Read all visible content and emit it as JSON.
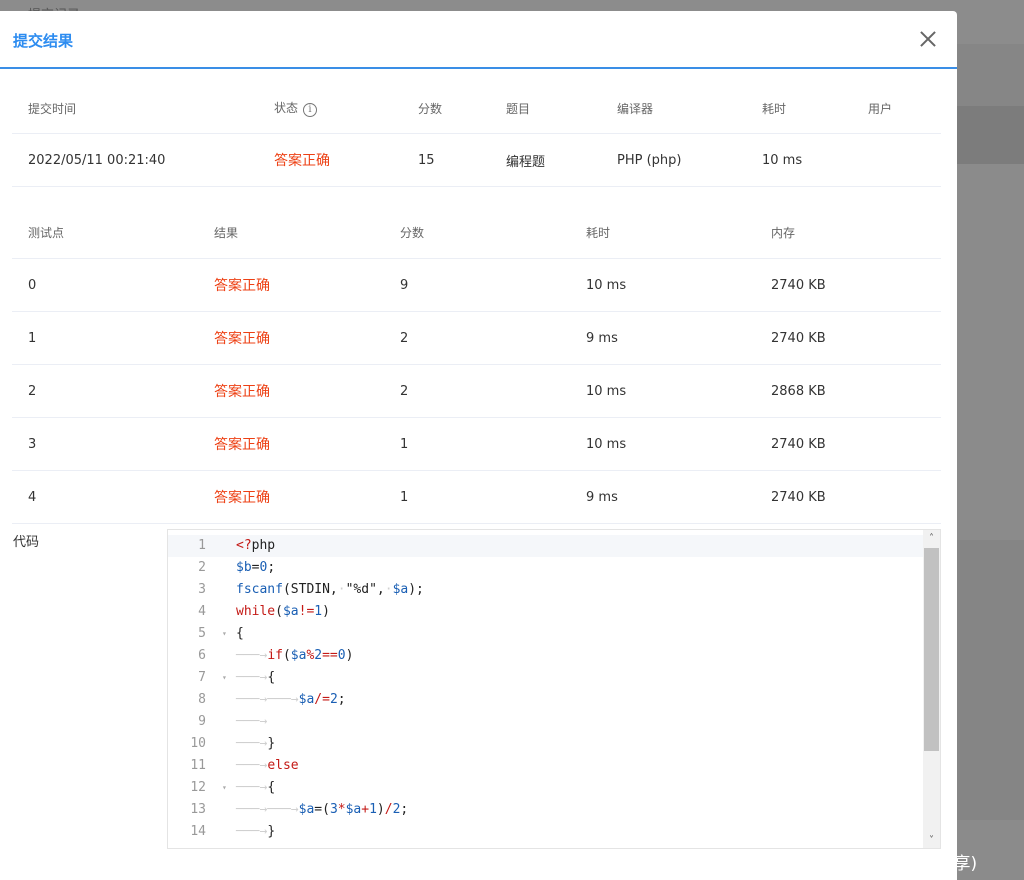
{
  "background": {
    "header_text": "提交记录"
  },
  "modal": {
    "title": "提交结果",
    "summary": {
      "headers": [
        "提交时间",
        "状态",
        "分数",
        "题目",
        "编译器",
        "耗时",
        "用户"
      ],
      "row": {
        "time": "2022/05/11 00:21:40",
        "status": "答案正确",
        "score": "15",
        "problem": "编程题",
        "compiler": "PHP (php)",
        "elapsed": "10 ms",
        "user": ""
      }
    },
    "cases": {
      "headers": [
        "测试点",
        "结果",
        "分数",
        "耗时",
        "内存"
      ],
      "rows": [
        {
          "id": "0",
          "result": "答案正确",
          "score": "9",
          "time": "10 ms",
          "memory": "2740 KB"
        },
        {
          "id": "1",
          "result": "答案正确",
          "score": "2",
          "time": "9 ms",
          "memory": "2740 KB"
        },
        {
          "id": "2",
          "result": "答案正确",
          "score": "2",
          "time": "10 ms",
          "memory": "2868 KB"
        },
        {
          "id": "3",
          "result": "答案正确",
          "score": "1",
          "time": "10 ms",
          "memory": "2740 KB"
        },
        {
          "id": "4",
          "result": "答案正确",
          "score": "1",
          "time": "9 ms",
          "memory": "2740 KB"
        }
      ]
    },
    "code": {
      "label": "代码",
      "line_numbers": [
        "1",
        "2",
        "3",
        "4",
        "5",
        "6",
        "7",
        "8",
        "9",
        "10",
        "11",
        "12",
        "13",
        "14"
      ]
    }
  },
  "watermark": "CSDN @贵哥的编程之路(热爱分享)",
  "colors": {
    "accent": "#2d8cf0",
    "success_text": "#ed4014"
  }
}
